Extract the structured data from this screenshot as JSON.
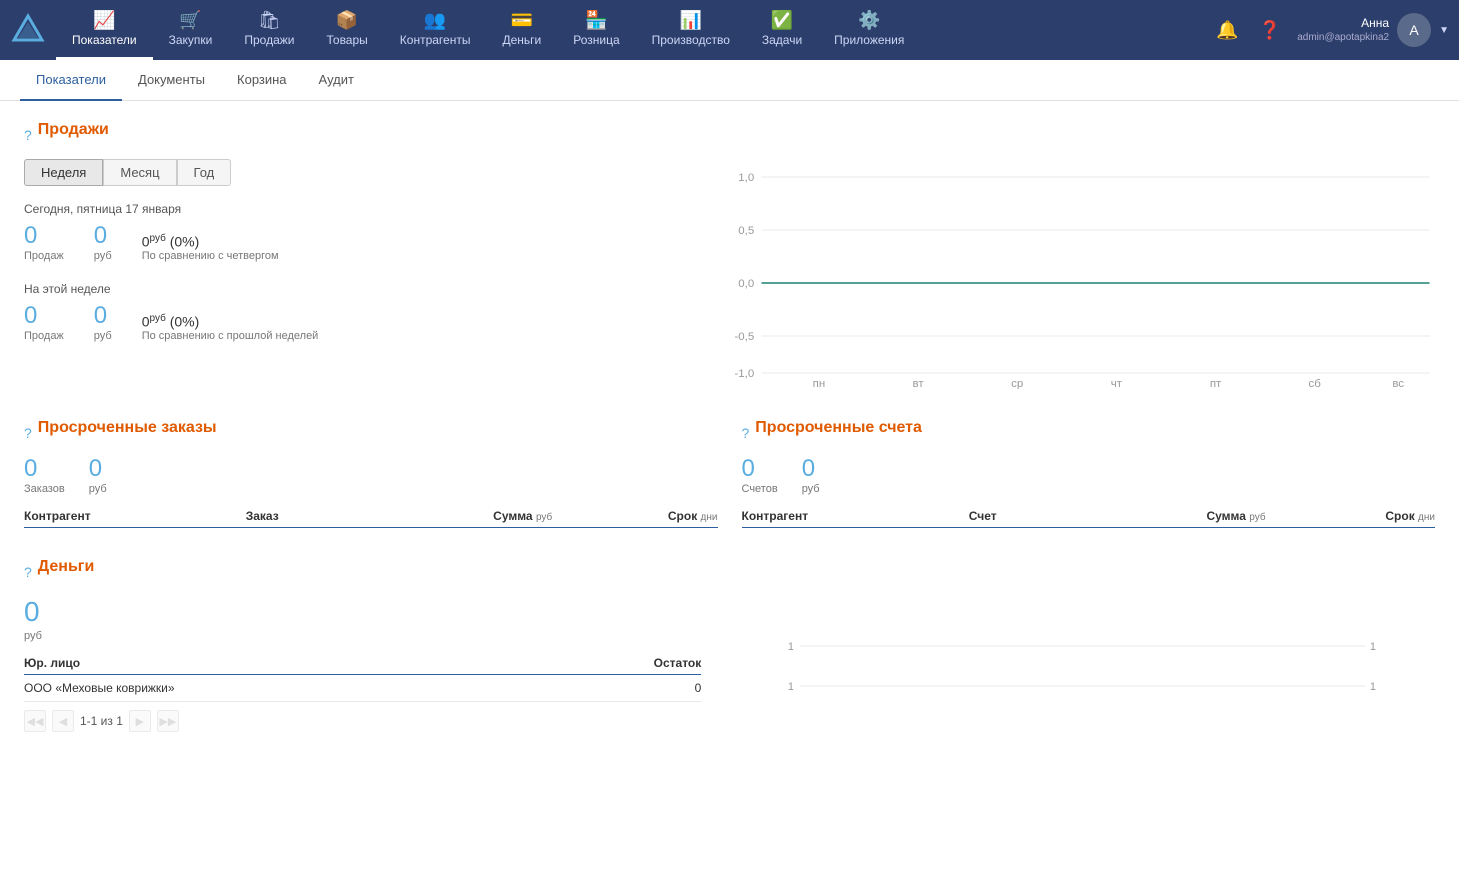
{
  "topNav": {
    "items": [
      {
        "id": "pokazateli",
        "label": "Показатели",
        "icon": "📈",
        "active": true
      },
      {
        "id": "zakupki",
        "label": "Закупки",
        "icon": "🛒",
        "active": false
      },
      {
        "id": "prodazhi",
        "label": "Продажи",
        "icon": "🛍",
        "active": false
      },
      {
        "id": "tovary",
        "label": "Товары",
        "icon": "📦",
        "active": false
      },
      {
        "id": "kontragenty",
        "label": "Контрагенты",
        "icon": "👥",
        "active": false
      },
      {
        "id": "dengi",
        "label": "Деньги",
        "icon": "💳",
        "active": false
      },
      {
        "id": "roznica",
        "label": "Розница",
        "icon": "🏪",
        "active": false
      },
      {
        "id": "proizvodstvo",
        "label": "Производство",
        "icon": "📊",
        "active": false
      },
      {
        "id": "zadachi",
        "label": "Задачи",
        "icon": "✅",
        "active": false
      },
      {
        "id": "prilozhenia",
        "label": "Приложения",
        "icon": "⚙️",
        "active": false
      }
    ],
    "user": {
      "name": "Анна",
      "email": "admin@apotapkina2"
    }
  },
  "subNav": {
    "items": [
      {
        "id": "pokazateli",
        "label": "Показатели",
        "active": true
      },
      {
        "id": "dokumenty",
        "label": "Документы",
        "active": false
      },
      {
        "id": "korzina",
        "label": "Корзина",
        "active": false
      },
      {
        "id": "audit",
        "label": "Аудит",
        "active": false
      }
    ]
  },
  "sections": {
    "sales": {
      "title": "Продажи",
      "periodButtons": [
        {
          "label": "Неделя",
          "active": true
        },
        {
          "label": "Месяц",
          "active": false
        },
        {
          "label": "Год",
          "active": false
        }
      ],
      "today": {
        "subtitle": "Сегодня, пятница 17 января",
        "stats": [
          {
            "value": "0",
            "label": "Продаж"
          },
          {
            "value": "0",
            "label": "руб"
          }
        ],
        "comparison": "0руб (0%)",
        "comparisonLabel": "По сравнению с четвергом"
      },
      "week": {
        "subtitle": "На этой неделе",
        "stats": [
          {
            "value": "0",
            "label": "Продаж"
          },
          {
            "value": "0",
            "label": "руб"
          }
        ],
        "comparison": "0руб (0%)",
        "comparisonLabel": "По сравнению с прошлой неделей"
      },
      "chart": {
        "yLabels": [
          "1,0",
          "0,5",
          "0,0",
          "-0,5",
          "-1,0"
        ],
        "xLabels": [
          "пн",
          "вт",
          "ср",
          "чт",
          "пт",
          "сб",
          "вс"
        ]
      }
    },
    "overdueOrders": {
      "title": "Просроченные заказы",
      "stats": [
        {
          "value": "0",
          "label": "Заказов"
        },
        {
          "value": "0",
          "label": "руб"
        }
      ],
      "tableHeaders": [
        {
          "text": "Контрагент",
          "align": "left"
        },
        {
          "text": "Заказ",
          "align": "left"
        },
        {
          "text": "Сумма",
          "subtext": "руб",
          "align": "right"
        },
        {
          "text": "Срок",
          "subtext": "дни",
          "align": "right"
        }
      ]
    },
    "overdueInvoices": {
      "title": "Просроченные счета",
      "stats": [
        {
          "value": "0",
          "label": "Счетов"
        },
        {
          "value": "0",
          "label": "руб"
        }
      ],
      "tableHeaders": [
        {
          "text": "Контрагент",
          "align": "left"
        },
        {
          "text": "Счет",
          "align": "left"
        },
        {
          "text": "Сумма",
          "subtext": "руб",
          "align": "right"
        },
        {
          "text": "Срок",
          "subtext": "дни",
          "align": "right"
        }
      ]
    },
    "money": {
      "title": "Деньги",
      "total": "0",
      "totalLabel": "руб",
      "tableHeaders": [
        {
          "text": "Юр. лицо",
          "align": "left"
        },
        {
          "text": "Остаток",
          "align": "right"
        }
      ],
      "rows": [
        {
          "name": "ООО «Меховые коврижки»",
          "amount": "0"
        }
      ],
      "pagination": {
        "text": "1-1 из 1"
      },
      "miniChart": {
        "lines": [
          {
            "y1Label": "1",
            "y2Label": "1"
          },
          {
            "y1Label": "1",
            "y2Label": "1"
          }
        ]
      }
    }
  }
}
